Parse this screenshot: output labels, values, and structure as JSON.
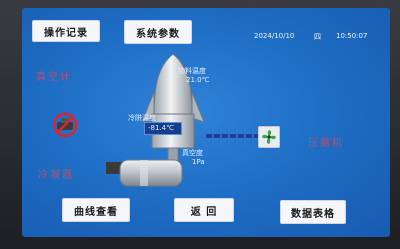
{
  "header": {
    "op_log_button": "操作记录",
    "params_button": "系统参数",
    "date": "2024/10/10",
    "weekday": "四",
    "time": "10:50:07"
  },
  "left_labels": {
    "vacuum_meter": "真空计",
    "cold_trap": "冷凝器"
  },
  "readings": {
    "material_temp_label": "物料温度",
    "material_temp_value": "21.0℃",
    "cold_trap_temp_label": "冷阱温度",
    "cold_trap_temp_value": "-81.4℃",
    "vacuum_label": "真空度",
    "vacuum_value": "1Pa"
  },
  "right_label": "压缩机",
  "footer": {
    "curve_button": "曲线查看",
    "back_button": "返 回",
    "data_table_button": "数据表格"
  },
  "colors": {
    "screen_bg": "#1f6fc6",
    "button_bg": "#f4f6fa",
    "label_red": "#d94b5b",
    "fan_green": "#3aa34a"
  }
}
